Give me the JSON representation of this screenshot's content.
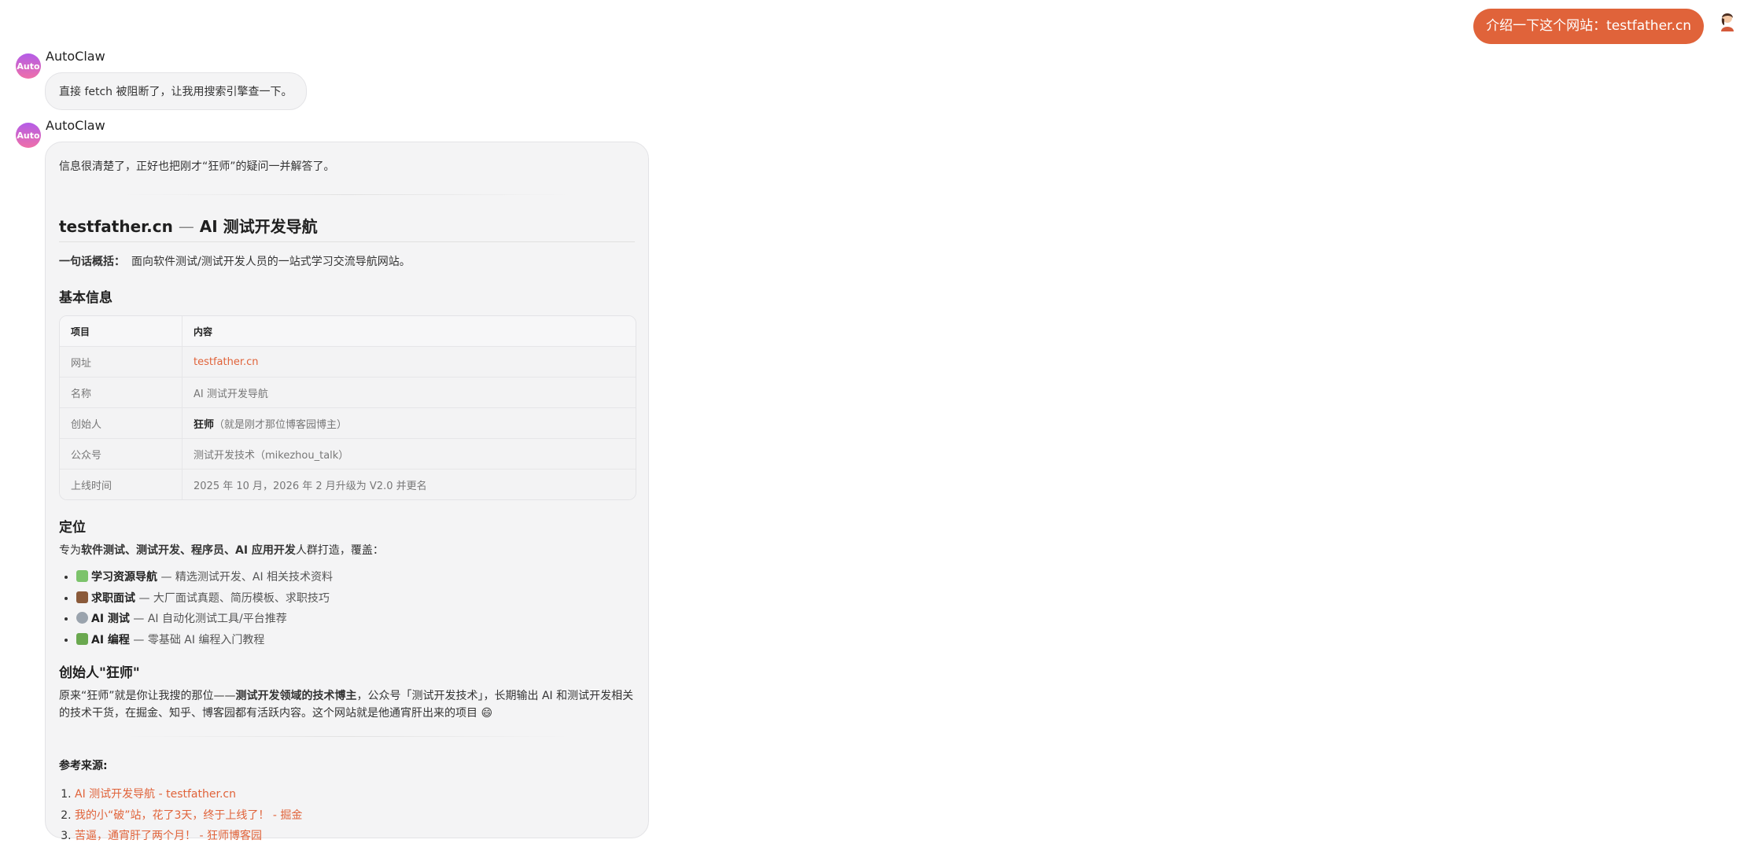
{
  "user_message": {
    "text": "介绍一下这个网站：testfather.cn"
  },
  "messages": [
    {
      "sender": "AutoClaw",
      "avatar_label": "Auto",
      "text": "直接 fetch 被阻断了，让我用搜索引擎查一下。"
    },
    {
      "sender": "AutoClaw",
      "avatar_label": "Auto",
      "intro": "信息很清楚了，正好也把刚才“狂师”的疑问一并解答了。",
      "title_site": "testfather.cn",
      "title_sep": "—",
      "title_rest": "AI 测试开发导航",
      "summary_label": "一句话概括：",
      "summary_text": "面向软件测试/测试开发人员的一站式学习交流导航网站。",
      "basic_heading": "基本信息",
      "table": {
        "headers": [
          "项目",
          "内容"
        ],
        "rows": [
          {
            "key": "网址",
            "value": "testfather.cn"
          },
          {
            "key": "名称",
            "value": "AI 测试开发导航"
          },
          {
            "key": "创始人",
            "value_bold": "狂师",
            "value": "（就是刚才那位博客园博主）"
          },
          {
            "key": "公众号",
            "value": "测试开发技术（mikezhou_talk）"
          },
          {
            "key": "上线时间",
            "value": "2025 年 10 月，2026 年 2 月升级为 V2.0 并更名"
          }
        ]
      },
      "position_heading": "定位",
      "position_pre": "专为",
      "position_bold": "软件测试、测试开发、程序员、AI 应用开发",
      "position_post": "人群打造，覆盖：",
      "features": [
        {
          "emoji": "📚",
          "bold": "学习资源导航",
          "rest": " — 精选测试开发、AI 相关技术资料"
        },
        {
          "emoji": "💼",
          "bold": "求职面试",
          "rest": " — 大厂面试真题、简历模板、求职技巧"
        },
        {
          "emoji": "🤖",
          "bold": "AI 测试",
          "rest": " — AI 自动化测试工具/平台推荐"
        },
        {
          "emoji": "👨‍💻",
          "bold": "AI 编程",
          "rest": " — 零基础 AI 编程入门教程"
        }
      ],
      "founder_heading": "创始人\"狂师\"",
      "founder_pre": "原来“狂师”就是你让我搜的那位——",
      "founder_bold": "测试开发领域的技术博主",
      "founder_post": "，公众号「测试开发技术」，长期输出 AI 和测试开发相关的技术干货，在掘金、知乎、博客园都有活跃内容。这个网站就是他通宵肝出来的项目 😄",
      "refs_label": "参考来源:",
      "refs": [
        "AI 测试开发导航 - testfather.cn",
        "我的小“破”站，花了3天，终于上线了！ - 掘金",
        "苦逼，通宵肝了两个月！ - 狂师博客园"
      ]
    }
  ],
  "colors": {
    "accent": "#e0633a",
    "bubble_bg": "#f4f4f5",
    "avatar_gradient": [
      "#b35ce8",
      "#ef6fa8"
    ]
  }
}
